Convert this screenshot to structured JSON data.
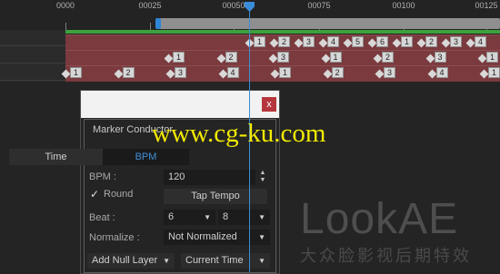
{
  "timeline": {
    "ruler_labels": [
      "0000",
      "00025",
      "00050",
      "00075",
      "00100",
      "00125"
    ],
    "layer_colors": {
      "marker_track": "#7a3a3e",
      "work_area": "#3da13d",
      "playhead": "#3a8cd8"
    },
    "tracks": [
      {
        "markers": [
          "1",
          "2",
          "3",
          "4",
          "5",
          "6",
          "1",
          "2",
          "3",
          "4"
        ]
      },
      {
        "markers": [
          "1",
          "2",
          "3",
          "1",
          "2",
          "3",
          "1",
          "2",
          "3",
          "1"
        ]
      },
      {
        "markers": [
          "1",
          "2",
          "3",
          "4",
          "1",
          "2",
          "3",
          "4",
          "1",
          "2"
        ]
      }
    ]
  },
  "panel": {
    "close_label": "x",
    "header_text": "Marker Conductor",
    "tabs": {
      "time": "Time",
      "bpm": "BPM"
    },
    "bpm_label": "BPM :",
    "bpm_value": "120",
    "round_label": "Round",
    "round_checked": true,
    "tap_tempo_label": "Tap Tempo",
    "beat_label": "Beat :",
    "beat_numerator": "6",
    "beat_denominator": "8",
    "normalize_label": "Normalize :",
    "normalize_value": "Not Normalized",
    "add_null_label": "Add Null Layer",
    "time_mode_value": "Current Time"
  },
  "watermarks": {
    "url": "www.cg-ku.com",
    "logo": "LookAE",
    "tagline": "大众脸影视后期特效"
  }
}
